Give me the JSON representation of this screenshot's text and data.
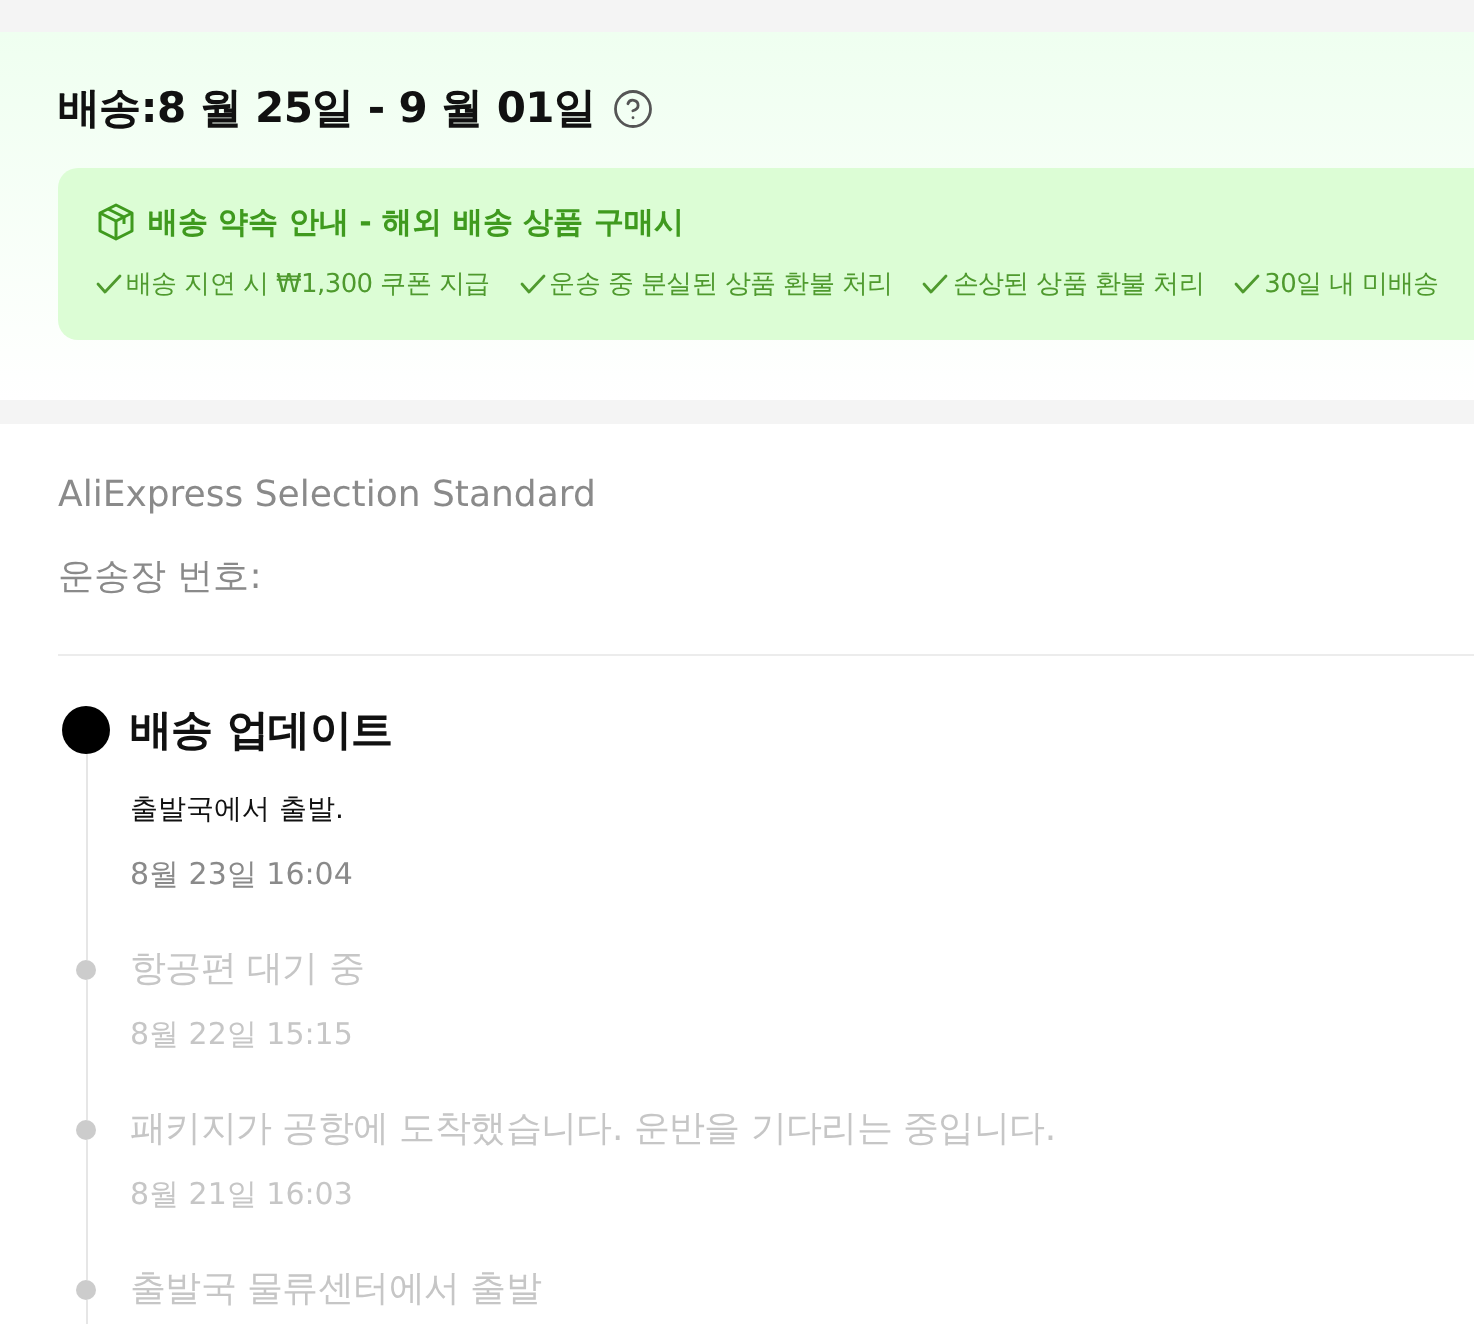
{
  "delivery": {
    "title": "배송:8 월 25일 - 9 월 01일"
  },
  "promise": {
    "title": "배송 약속 안내 - 해외 배송 상품 구매시",
    "items": [
      "배송 지연 시 ₩1,300 쿠폰 지급",
      "운송 중 분실된 상품 환불 처리",
      "손상된 상품 환불 처리",
      "30일 내 미배송"
    ]
  },
  "shipping": {
    "carrier": "AliExpress Selection Standard",
    "tracking_label": "운송장 번호:"
  },
  "timeline": [
    {
      "title": "배송 업데이트",
      "detail": "출발국에서 출발.",
      "time": "8월 23일 16:04",
      "active": true
    },
    {
      "title": "항공편 대기 중",
      "time": "8월 22일 15:15",
      "active": false
    },
    {
      "title": "패키지가 공항에 도착했습니다. 운반을 기다리는 중입니다.",
      "time": "8월 21일 16:03",
      "active": false
    },
    {
      "title": "출발국 물류센터에서 출발",
      "active": false
    }
  ]
}
